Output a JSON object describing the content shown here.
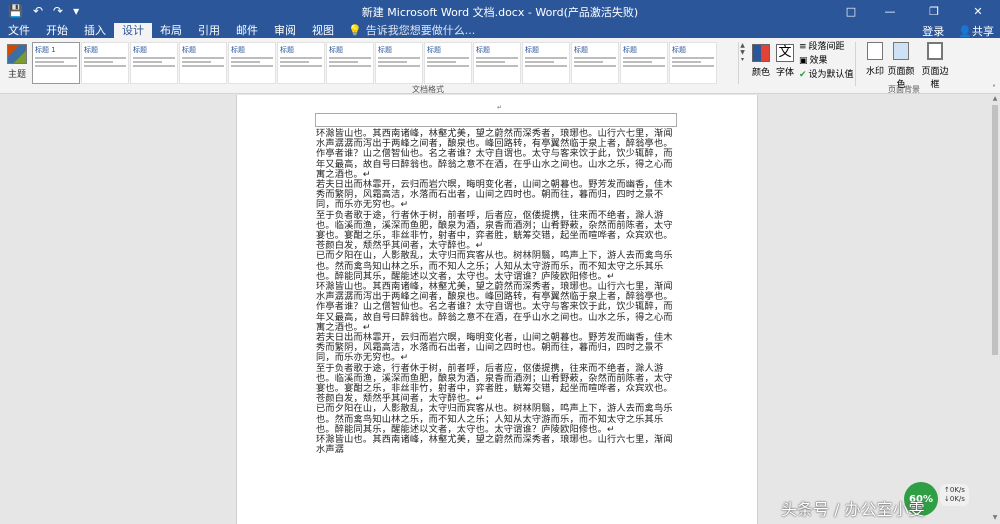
{
  "window": {
    "title": "新建 Microsoft Word 文档.docx - Word(产品激活失败)",
    "quick_access": [
      "save-icon",
      "undo-icon",
      "redo-icon",
      "customize-icon"
    ],
    "controls": [
      "□",
      "—",
      "❐",
      "✕"
    ]
  },
  "tabs": {
    "items": [
      "文件",
      "开始",
      "插入",
      "设计",
      "布局",
      "引用",
      "邮件",
      "审阅",
      "视图"
    ],
    "active": "设计",
    "tell_me": "告诉我您想要做什么...",
    "signin": "登录",
    "share": "共享"
  },
  "ribbon": {
    "theme_label": "主题",
    "styles": [
      {
        "title": "标题 1"
      },
      {
        "title": "标题"
      },
      {
        "title": "标题"
      },
      {
        "title": "标题"
      },
      {
        "title": "标题"
      },
      {
        "title": "标题"
      },
      {
        "title": "标题"
      },
      {
        "title": "标题"
      },
      {
        "title": "标题"
      },
      {
        "title": "标题"
      },
      {
        "title": "标题"
      },
      {
        "title": "标题"
      },
      {
        "title": "标题"
      },
      {
        "title": "标题"
      }
    ],
    "doc_format_label": "文档格式",
    "colors_label": "颜色",
    "fonts_label": "字体",
    "fonts_glyph": "文",
    "paragraph_spacing": "段落间距",
    "effects": "效果",
    "set_default": "设为默认值",
    "watermark_label": "水印",
    "page_color_label": "页面颜色",
    "page_borders_label": "页面边框",
    "page_bg_label": "页面背景"
  },
  "document": {
    "paragraphs": [
      "环滁皆山也。其西南诸峰，林壑尤美，望之蔚然而深秀者，琅琊也。山行六七里，渐闻水声潺潺而泻出于两峰之间者，酿泉也。峰回路转，有亭翼然临于泉上者，醉翁亭也。作亭者谁？山之僧智仙也。名之者谁？太守自谓也。太守与客来饮于此，饮少辄醉，而年又最高，故自号曰醉翁也。醉翁之意不在酒，在乎山水之间也。山水之乐，得之心而寓之酒也。↵",
      "若夫日出而林霏开，云归而岩穴暝，晦明变化者，山间之朝暮也。野芳发而幽香，佳木秀而繁阴，风霜高洁，水落而石出者，山间之四时也。朝而往，暮而归，四时之景不同，而乐亦无穷也。↵",
      "至于负者歌于途，行者休于树，前者呼，后者应，伛偻提携，往来而不绝者，滁人游也。临溪而渔，溪深而鱼肥，酿泉为酒，泉香而酒洌；山肴野蔌，杂然而前陈者，太守宴也。宴酣之乐，非丝非竹，射者中，弈者胜，觥筹交错，起坐而喧哗者，众宾欢也。苍颜白发，颓然乎其间者，太守醉也。↵",
      "已而夕阳在山，人影散乱，太守归而宾客从也。树林阴翳，鸣声上下，游人去而禽鸟乐也。然而禽鸟知山林之乐，而不知人之乐；人知从太守游而乐，而不知太守之乐其乐也。醉能同其乐，醒能述以文者，太守也。太守谓谁？庐陵欧阳修也。↵",
      "环滁皆山也。其西南诸峰，林壑尤美，望之蔚然而深秀者，琅琊也。山行六七里，渐闻水声潺潺而泻出于两峰之间者，酿泉也。峰回路转，有亭翼然临于泉上者，醉翁亭也。作亭者谁？山之僧智仙也。名之者谁？太守自谓也。太守与客来饮于此，饮少辄醉，而年又最高，故自号曰醉翁也。醉翁之意不在酒，在乎山水之间也。山水之乐，得之心而寓之酒也。↵",
      "若夫日出而林霏开，云归而岩穴暝，晦明变化者，山间之朝暮也。野芳发而幽香，佳木秀而繁阴，风霜高洁，水落而石出者，山间之四时也。朝而往，暮而归，四时之景不同，而乐亦无穷也。↵",
      "至于负者歌于途，行者休于树，前者呼，后者应，伛偻提携，往来而不绝者，滁人游也。临溪而渔，溪深而鱼肥，酿泉为酒，泉香而酒洌；山肴野蔌，杂然而前陈者，太守宴也。宴酣之乐，非丝非竹，射者中，弈者胜，觥筹交错，起坐而喧哗者，众宾欢也。苍颜白发，颓然乎其间者，太守醉也。↵",
      "已而夕阳在山，人影散乱，太守归而宾客从也。树林阴翳，鸣声上下，游人去而禽鸟乐也。然而禽鸟知山林之乐，而不知人之乐；人知从太守游而乐，而不知太守之乐其乐也。醉能同其乐，醒能述以文者，太守也。太守谓谁？庐陵欧阳修也。↵",
      "环滁皆山也。其西南诸峰，林壑尤美，望之蔚然而深秀者，琅琊也。山行六七里，渐闻水声潺"
    ],
    "header_mark": "↵"
  },
  "overlay": {
    "net_percent": "60%",
    "net_up": "0K/s",
    "net_down": "0K/s",
    "watermark": "头条号 / 办公室小雯"
  },
  "colors": {
    "brand": "#2b579a",
    "net_green": "#2f9e44"
  }
}
